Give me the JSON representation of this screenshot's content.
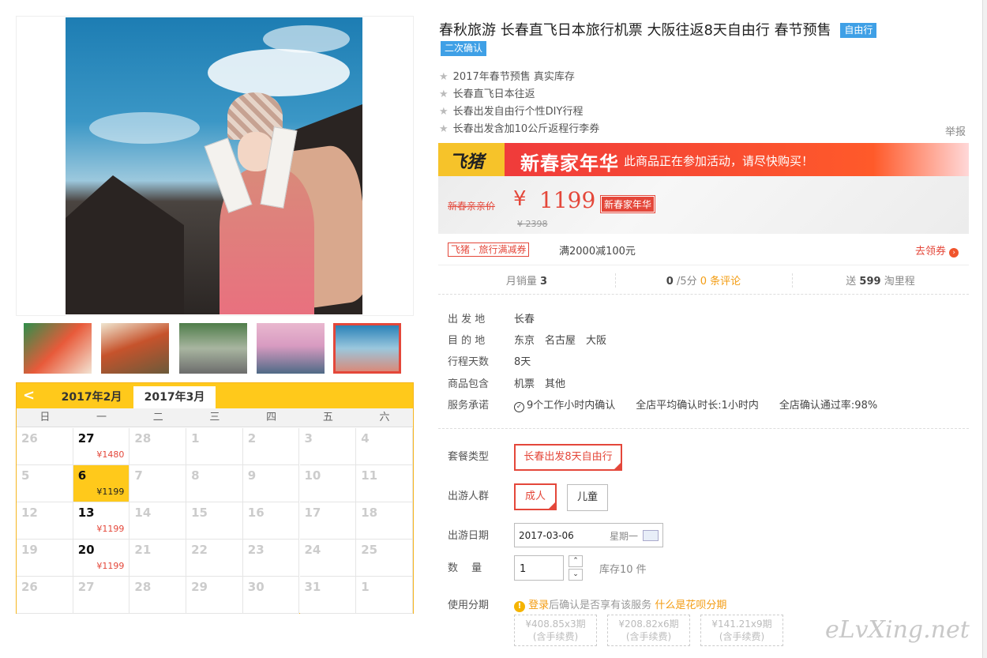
{
  "product": {
    "title": "春秋旅游 长春直飞日本旅行机票 大阪往返8天自由行 春节预售",
    "tag_free": "自由行",
    "tag_confirm": "二次确认",
    "report": "举报"
  },
  "features": [
    "2017年春节预售 真实库存",
    "长春直飞日本往返",
    "长春出发自由行个性DIY行程",
    "长春出发含加10公斤返程行李券"
  ],
  "banner": {
    "logo": "飞猪",
    "title": "新春家年华",
    "message": "此商品正在参加活动，请尽快购买！"
  },
  "price": {
    "label": "新春亲亲价",
    "currency": "¥",
    "value": "1199",
    "badge": "新春家年华",
    "original": "¥ 2398"
  },
  "coupon": {
    "badge": "飞猪 · 旅行满减券",
    "text": "满2000减100元",
    "link": "去领券"
  },
  "stats": {
    "sales_label": "月销量",
    "sales": "3",
    "rating": "0",
    "rating_suffix": "/5分",
    "reviews": "0 条评论",
    "points_prefix": "送",
    "points": "599",
    "points_suffix": "淘里程"
  },
  "details": [
    {
      "label": "出 发 地",
      "value": "长春"
    },
    {
      "label": "目 的 地",
      "value": "东京　名古屋　大阪"
    },
    {
      "label": "行程天数",
      "value": "8天"
    },
    {
      "label": "商品包含",
      "value": "机票　其他"
    },
    {
      "label": "服务承诺",
      "value": "9个工作小时内确认　　全店平均确认时长:1小时内　　全店确认通过率:98%"
    }
  ],
  "options": {
    "package_label": "套餐类型",
    "package": "长春出发8天自由行",
    "crowd_label": "出游人群",
    "crowd_adult": "成人",
    "crowd_child": "儿童",
    "date_label": "出游日期",
    "date": "2017-03-06",
    "weekday": "星期一",
    "qty_label": "数　 量",
    "qty": "1",
    "stock": "库存10 件",
    "installment_label": "使用分期",
    "login": "登录",
    "installment_text": "后确认是否享有该服务",
    "installment_link": "什么是花呗分期",
    "plans": [
      {
        "amount": "¥408.85x3期",
        "fee": "(含手续费)"
      },
      {
        "amount": "¥208.82x6期",
        "fee": "(含手续费)"
      },
      {
        "amount": "¥141.21x9期",
        "fee": "(含手续费)"
      }
    ]
  },
  "calendar": {
    "months": [
      "2017年2月",
      "2017年3月"
    ],
    "weekdays": [
      "日",
      "一",
      "二",
      "三",
      "四",
      "五",
      "六"
    ],
    "cells": [
      {
        "d": "26",
        "p": "",
        "on": false
      },
      {
        "d": "27",
        "p": "¥1480",
        "on": true
      },
      {
        "d": "28",
        "p": "",
        "on": false
      },
      {
        "d": "1",
        "p": "",
        "on": false
      },
      {
        "d": "2",
        "p": "",
        "on": false
      },
      {
        "d": "3",
        "p": "",
        "on": false
      },
      {
        "d": "4",
        "p": "",
        "on": false
      },
      {
        "d": "5",
        "p": "",
        "on": false
      },
      {
        "d": "6",
        "p": "¥1199",
        "on": true,
        "sel": true
      },
      {
        "d": "7",
        "p": "",
        "on": false
      },
      {
        "d": "8",
        "p": "",
        "on": false
      },
      {
        "d": "9",
        "p": "",
        "on": false
      },
      {
        "d": "10",
        "p": "",
        "on": false
      },
      {
        "d": "11",
        "p": "",
        "on": false
      },
      {
        "d": "12",
        "p": "",
        "on": false
      },
      {
        "d": "13",
        "p": "¥1199",
        "on": true
      },
      {
        "d": "14",
        "p": "",
        "on": false
      },
      {
        "d": "15",
        "p": "",
        "on": false
      },
      {
        "d": "16",
        "p": "",
        "on": false
      },
      {
        "d": "17",
        "p": "",
        "on": false
      },
      {
        "d": "18",
        "p": "",
        "on": false
      },
      {
        "d": "19",
        "p": "",
        "on": false
      },
      {
        "d": "20",
        "p": "¥1199",
        "on": true
      },
      {
        "d": "21",
        "p": "",
        "on": false
      },
      {
        "d": "22",
        "p": "",
        "on": false
      },
      {
        "d": "23",
        "p": "",
        "on": false
      },
      {
        "d": "24",
        "p": "",
        "on": false
      },
      {
        "d": "25",
        "p": "",
        "on": false
      },
      {
        "d": "26",
        "p": "",
        "on": false
      },
      {
        "d": "27",
        "p": "",
        "on": false
      },
      {
        "d": "28",
        "p": "",
        "on": false
      },
      {
        "d": "29",
        "p": "",
        "on": false
      },
      {
        "d": "30",
        "p": "",
        "on": false
      },
      {
        "d": "31",
        "p": "",
        "on": false
      },
      {
        "d": "1",
        "p": "",
        "on": false
      }
    ]
  },
  "watermark": "eLvXing.net",
  "colors": {
    "accent": "#e4473a",
    "calendar": "#ffc91b",
    "blue_tag": "#3fa0e6"
  }
}
